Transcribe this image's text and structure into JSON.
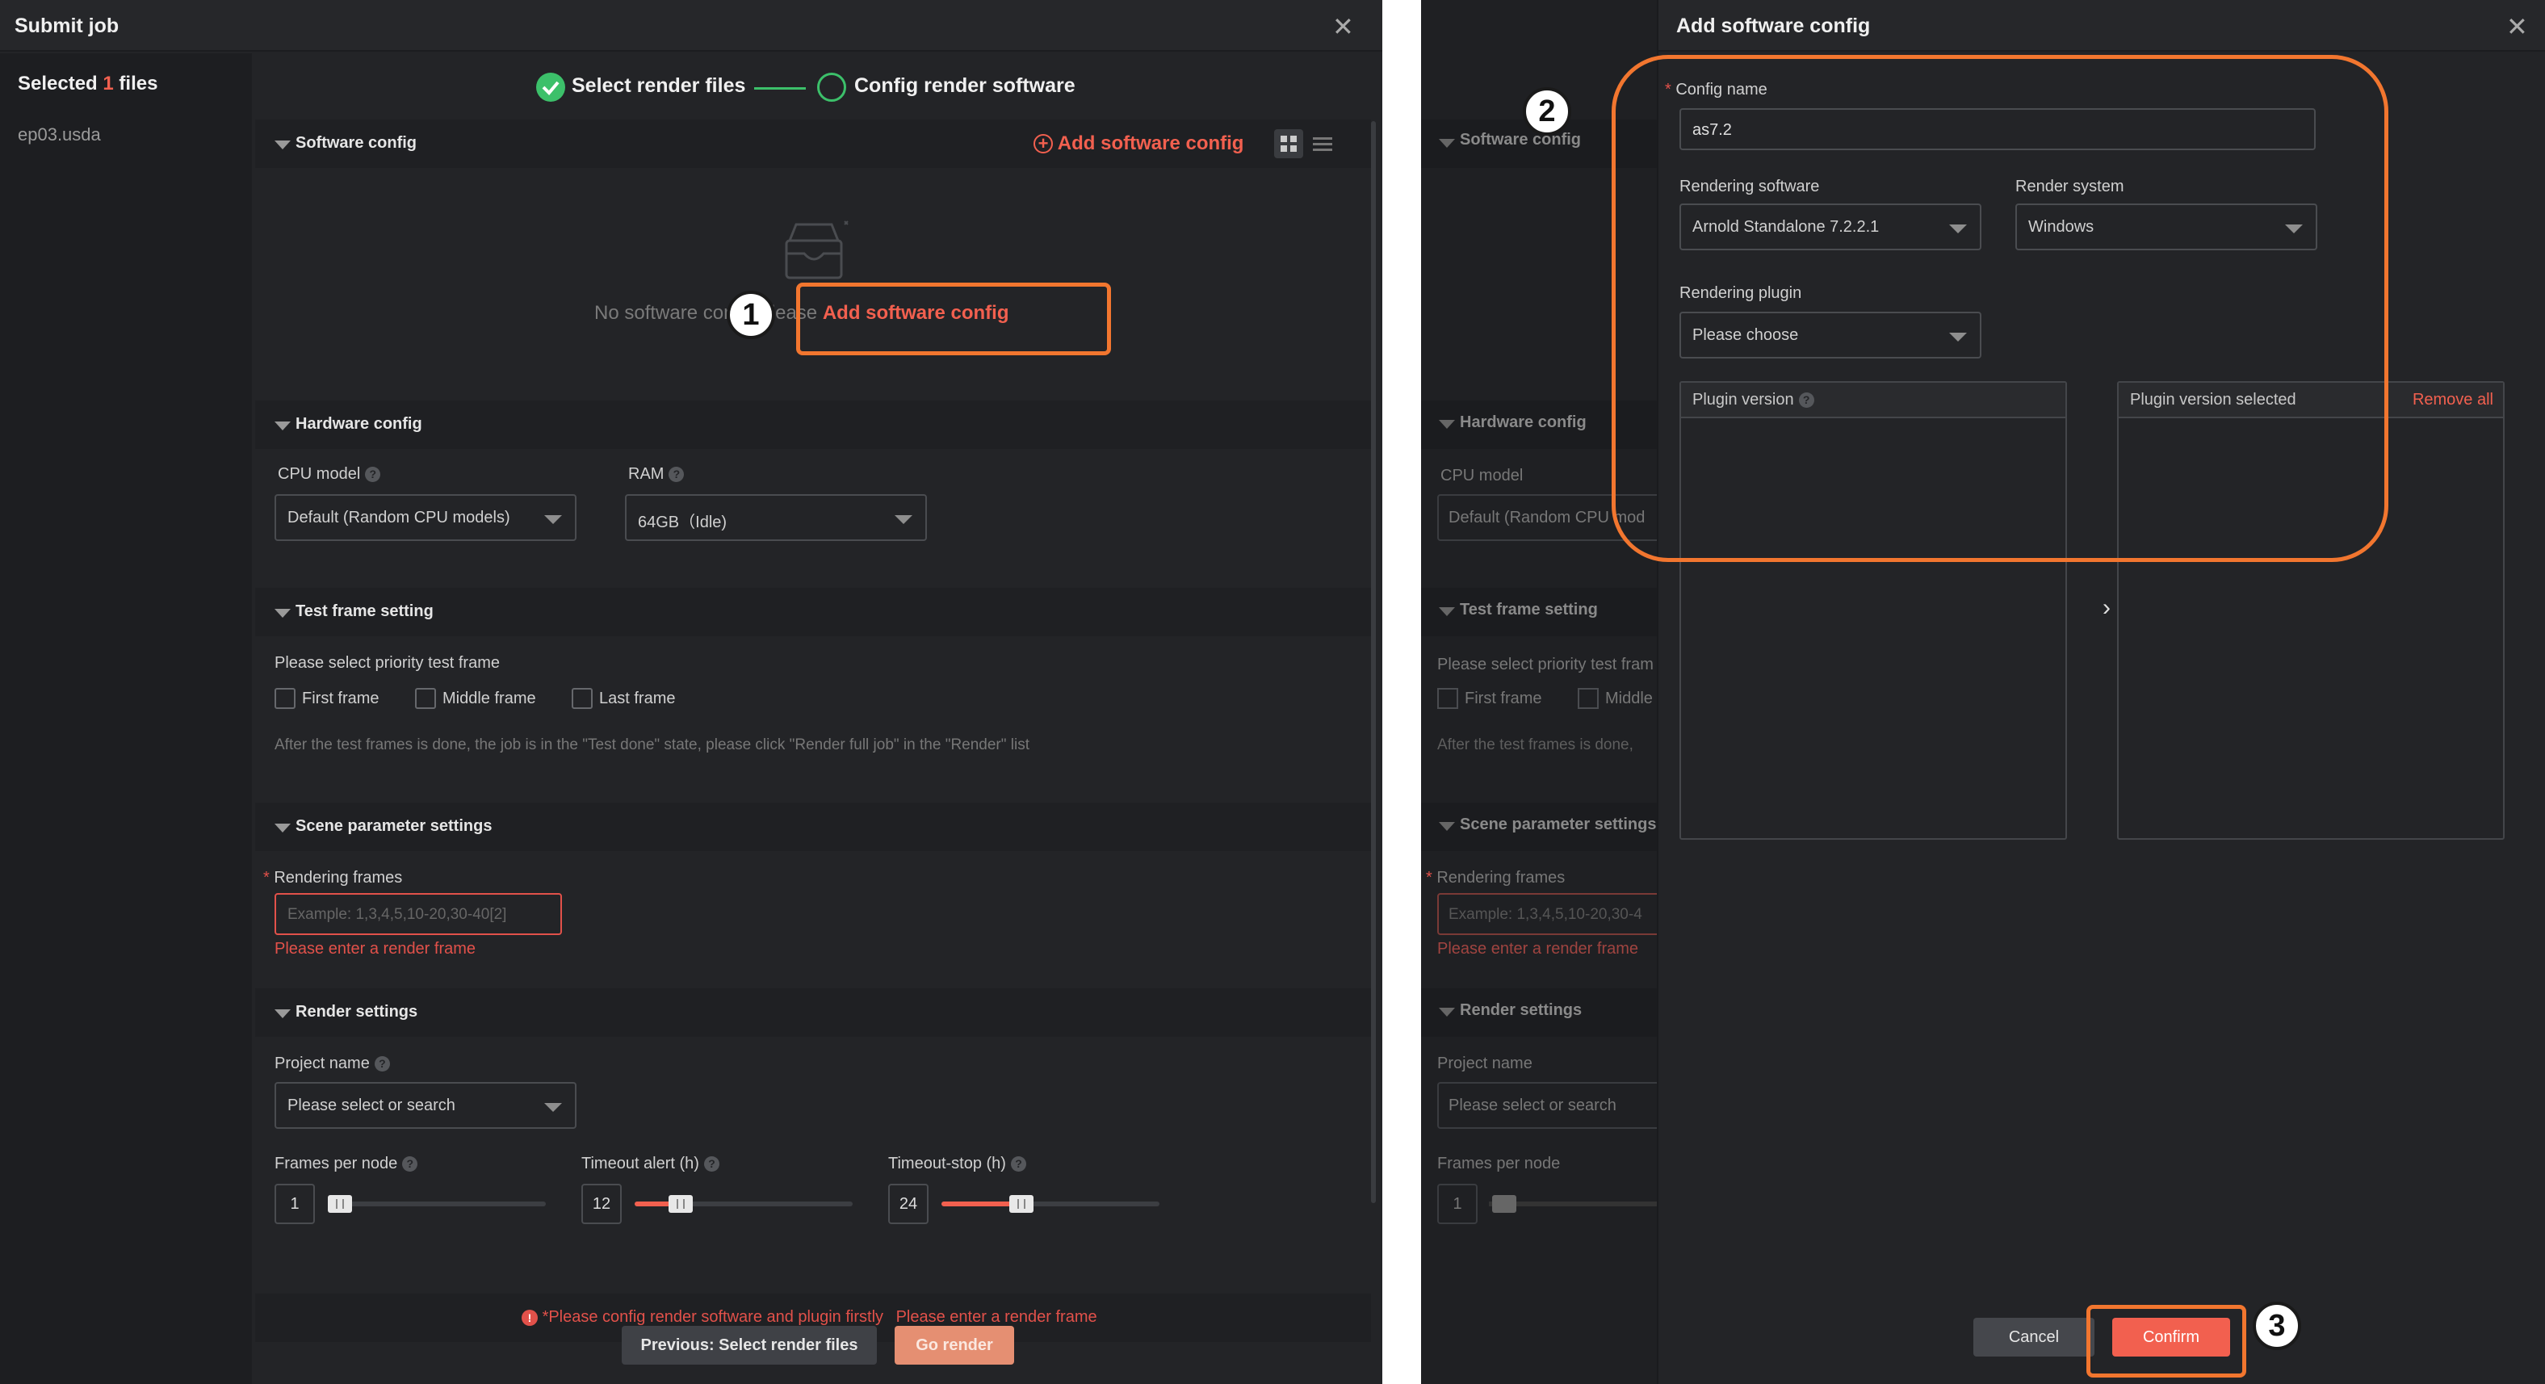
{
  "left_panel": {
    "title": "Submit job",
    "selected_prefix": "Selected",
    "selected_count": "1",
    "selected_suffix": "files",
    "file_name": "ep03.usda",
    "steps": {
      "step1": "Select render files",
      "step2": "Config render software"
    },
    "software_config": {
      "header": "Software config",
      "add_label": "Add software config",
      "empty_prefix": "No software config,please",
      "empty_link": "Add software config"
    },
    "hardware_config": {
      "header": "Hardware config",
      "cpu_label": "CPU model",
      "cpu_value": "Default (Random CPU models)",
      "ram_label": "RAM",
      "ram_value": "64GB（Idle)"
    },
    "test_frame": {
      "header": "Test frame setting",
      "prompt": "Please select priority test frame",
      "options": [
        "First frame",
        "Middle frame",
        "Last frame"
      ],
      "note": "After the test frames is done, the job is in the \"Test done\" state, please click \"Render full job\" in the \"Render\" list"
    },
    "scene_params": {
      "header": "Scene parameter settings",
      "frames_label": "Rendering frames",
      "frames_placeholder": "Example: 1,3,4,5,10-20,30-40[2]",
      "frames_error": "Please enter a render frame"
    },
    "render_settings": {
      "header": "Render settings",
      "project_label": "Project name",
      "project_placeholder": "Please select or search",
      "frames_per_node_label": "Frames per node",
      "frames_per_node": "1",
      "timeout_alert_label": "Timeout alert (h)",
      "timeout_alert": "12",
      "timeout_stop_label": "Timeout-stop (h)",
      "timeout_stop": "24"
    },
    "error_bar": {
      "msg1": "*Please config render software and plugin firstly",
      "msg2": "Please enter a render frame"
    },
    "buttons": {
      "previous": "Previous: Select render files",
      "go": "Go render"
    }
  },
  "right_panel": {
    "bg": {
      "software_config": "Software config",
      "hardware_config": "Hardware config",
      "cpu_label": "CPU model",
      "cpu_value": "Default (Random CPU mod",
      "test_frame": "Test frame setting",
      "test_prompt": "Please select priority test fram",
      "first_frame": "First frame",
      "middle": "Middle",
      "note": "After the test frames is done,",
      "scene_params": "Scene parameter settings",
      "frames_label": "Rendering frames",
      "frames_placeholder": "Example: 1,3,4,5,10-20,30-4",
      "frames_error": "Please enter a render frame",
      "render_settings": "Render settings",
      "project_label": "Project name",
      "project_placeholder": "Please select or search",
      "fpn_label": "Frames per node",
      "fpn_value": "1"
    },
    "dialog": {
      "title": "Add software config",
      "config_name_label": "Config name",
      "config_name_value": "as7.2",
      "software_label": "Rendering software",
      "software_value": "Arnold Standalone 7.2.2.1",
      "system_label": "Render system",
      "system_value": "Windows",
      "plugin_label": "Rendering plugin",
      "plugin_value": "Please choose",
      "plugin_version": "Plugin version",
      "plugin_selected": "Plugin version selected",
      "remove_all": "Remove all",
      "cancel": "Cancel",
      "confirm": "Confirm"
    }
  },
  "annotations": {
    "n1": "1",
    "n2": "2",
    "n3": "3"
  },
  "colors": {
    "accent": "#f2604f",
    "annotation": "#f2762f",
    "background": "#232427",
    "success": "#3cc06a"
  }
}
